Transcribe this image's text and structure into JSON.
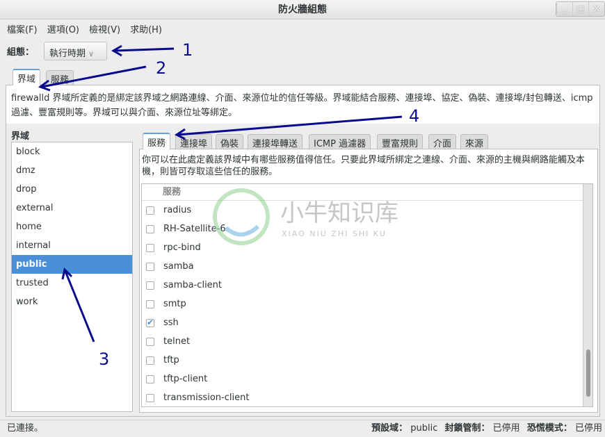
{
  "window": {
    "title": "防火牆組態",
    "buttons": [
      "_",
      "□",
      "X"
    ]
  },
  "menu": [
    "檔案(F)",
    "選項(O)",
    "檢視(V)",
    "求助(H)"
  ],
  "config": {
    "label": "組態：",
    "value": "執行時期"
  },
  "top_tabs": [
    {
      "label": "界域",
      "active": true
    },
    {
      "label": "服務",
      "active": false
    }
  ],
  "zones_description": "firewalld 界域所定義的是綁定該界域之網路連線、介面、來源位址的信任等級。界域能結合服務、連接埠、協定、偽裝、連接埠/封包轉送、icmp 過濾、豐富規則等。界域可以與介面、來源位址等綁定。",
  "zones": {
    "title": "界域",
    "items": [
      "block",
      "dmz",
      "drop",
      "external",
      "home",
      "internal",
      "public",
      "trusted",
      "work"
    ],
    "selected": "public"
  },
  "inner_tabs": [
    {
      "label": "服務",
      "active": true
    },
    {
      "label": "連接埠"
    },
    {
      "label": "偽裝"
    },
    {
      "label": "連接埠轉送"
    },
    {
      "label": "ICMP 過濾器"
    },
    {
      "label": "豐富規則"
    },
    {
      "label": "介面"
    },
    {
      "label": "來源"
    }
  ],
  "services": {
    "description": "你可以在此處定義該界域中有哪些服務值得信任。只要此界域所綁定之連線、介面、來源的主機與網路能觸及本機，則皆可存取這些信任的服務。",
    "header": "服務",
    "rows": [
      {
        "name": "radius",
        "checked": false
      },
      {
        "name": "RH-Satellite-6",
        "checked": false
      },
      {
        "name": "rpc-bind",
        "checked": false
      },
      {
        "name": "samba",
        "checked": false
      },
      {
        "name": "samba-client",
        "checked": false
      },
      {
        "name": "smtp",
        "checked": false
      },
      {
        "name": "ssh",
        "checked": true
      },
      {
        "name": "telnet",
        "checked": false
      },
      {
        "name": "tftp",
        "checked": false
      },
      {
        "name": "tftp-client",
        "checked": false
      },
      {
        "name": "transmission-client",
        "checked": false
      }
    ]
  },
  "status": {
    "left": "已連接。",
    "default_zone_label": "預設域：",
    "default_zone": "public",
    "lockdown_label": "封鎖管制：",
    "lockdown": "已停用",
    "panic_label": "恐慌模式：",
    "panic": "已停用"
  },
  "annotations": [
    "1",
    "2",
    "3",
    "4"
  ],
  "watermark": {
    "title": "小牛知识库",
    "subtitle": "XIAO NIU ZHI SHI KU"
  },
  "colors": {
    "accent": "#4a90d9",
    "annotation": "#0a0a8c"
  }
}
